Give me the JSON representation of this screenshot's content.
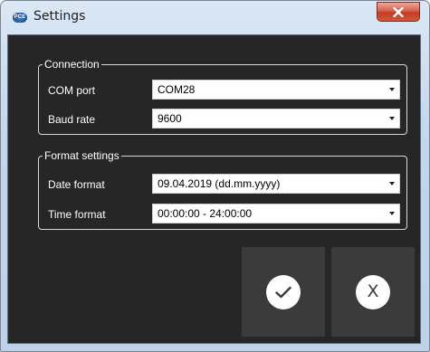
{
  "window": {
    "title": "Settings",
    "logo_text": "PCE",
    "close_label": "X"
  },
  "connection": {
    "legend": "Connection",
    "com_port_label": "COM port",
    "com_port_value": "COM28",
    "baud_rate_label": "Baud rate",
    "baud_rate_value": "9600"
  },
  "format": {
    "legend": "Format settings",
    "date_format_label": "Date format",
    "date_format_value": "09.04.2019 (dd.mm.yyyy)",
    "time_format_label": "Time format",
    "time_format_value": "00:00:00 - 24:00:00"
  },
  "buttons": {
    "ok_icon": "checkmark-icon",
    "cancel_icon": "x-icon",
    "cancel_glyph": "X"
  },
  "colors": {
    "client_background": "#262626",
    "button_background": "#3b3b3b",
    "close_button": "#c23d22"
  }
}
